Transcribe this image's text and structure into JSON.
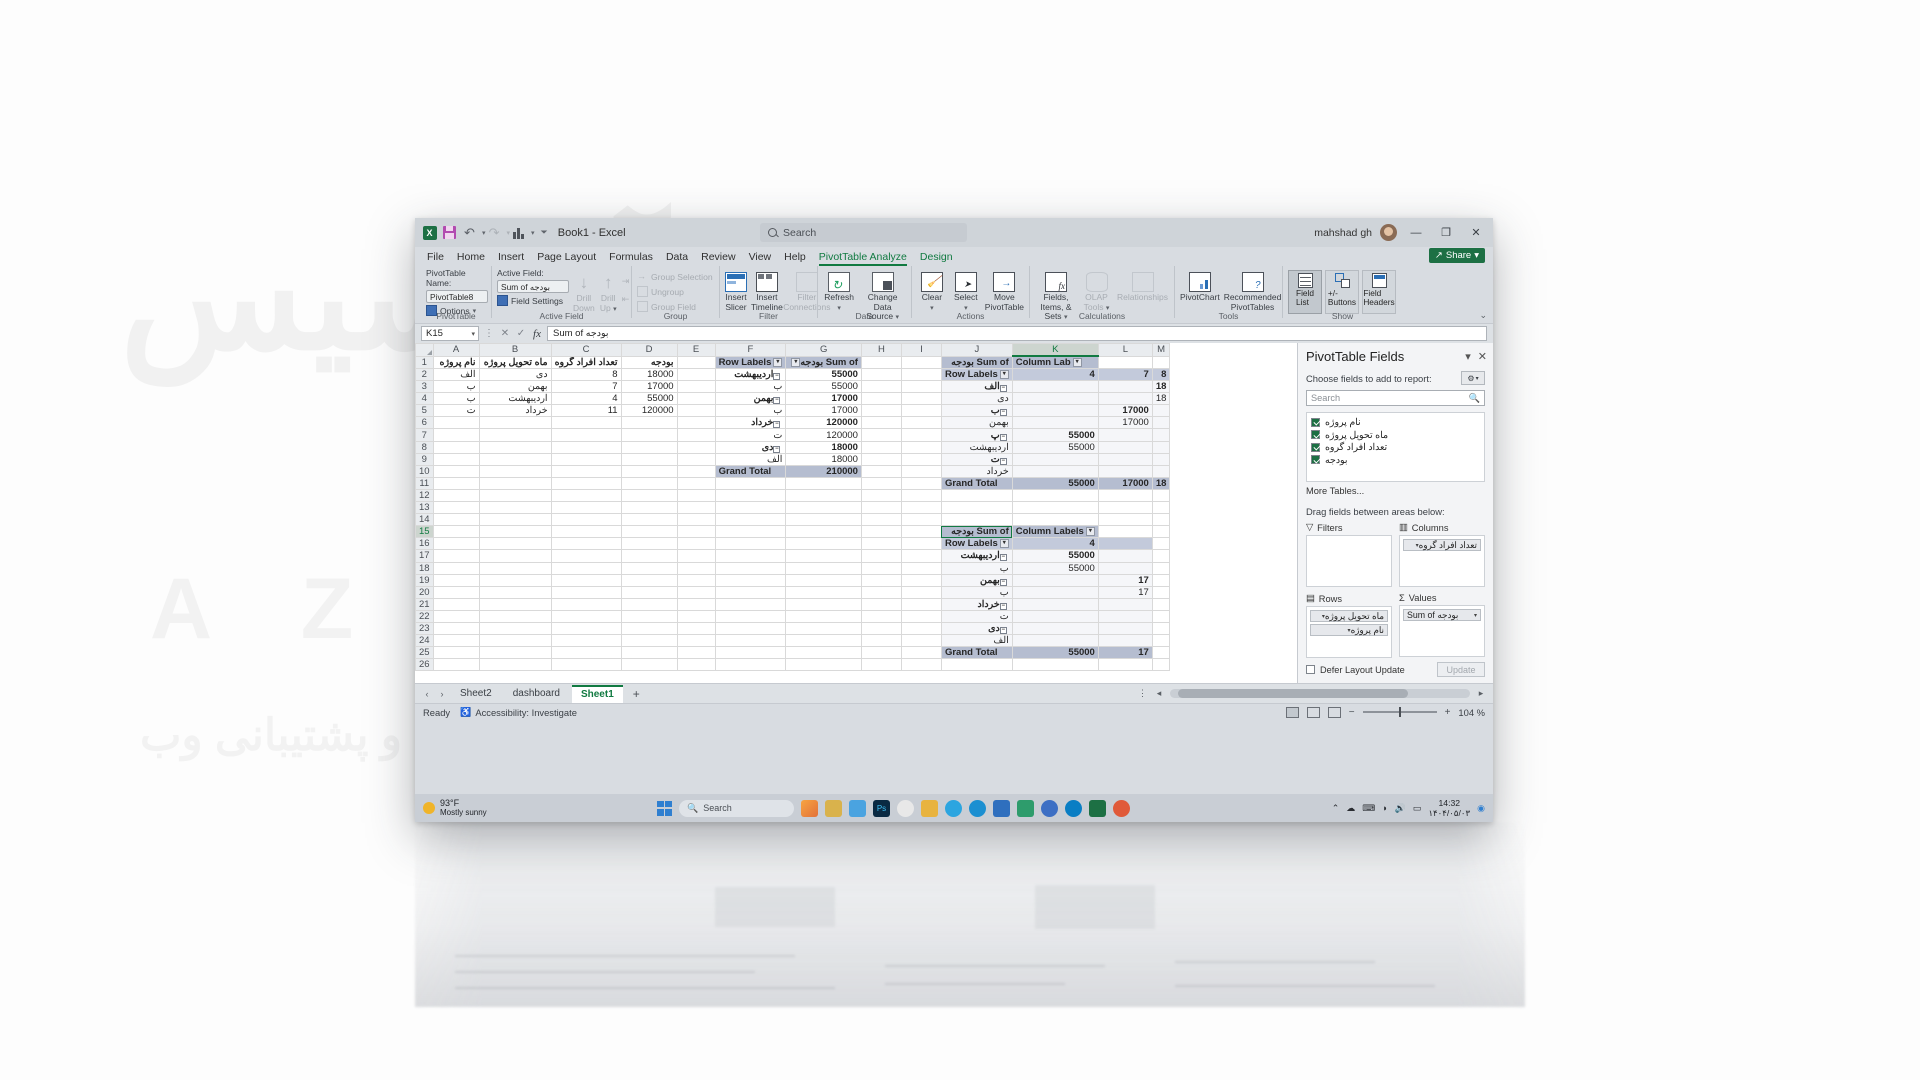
{
  "window": {
    "title": "Book1  -  Excel",
    "user": "mahshad gh",
    "buttons": {
      "minimize": "—",
      "maximize": "❐",
      "close": "✕"
    },
    "share_label": "Share"
  },
  "quick_access": {
    "excel_logo": "X",
    "items": [
      "save-icon",
      "undo-icon",
      "redo-icon",
      "chart-icon",
      "customize-icon"
    ]
  },
  "search": {
    "placeholder": "Search"
  },
  "ribbon": {
    "tabs": [
      "File",
      "Home",
      "Insert",
      "Page Layout",
      "Formulas",
      "Data",
      "Review",
      "View",
      "Help"
    ],
    "context_tabs": [
      "PivotTable Analyze",
      "Design"
    ],
    "active_tab": "PivotTable Analyze",
    "groups": [
      {
        "name": "PivotTable",
        "pivottable_name_label": "PivotTable Name:",
        "pivottable_name_value": "PivotTable8",
        "options_label": "Options"
      },
      {
        "name": "Active Field",
        "active_field_label": "Active Field:",
        "active_field_value": "Sum of بودجه",
        "field_settings_label": "Field Settings",
        "drill_down_label": "Drill Down",
        "drill_up_label": "Drill Up"
      },
      {
        "name": "Group",
        "items": [
          "Group Selection",
          "Ungroup",
          "Group Field"
        ]
      },
      {
        "name": "Filter",
        "items": [
          "Insert Slicer",
          "Insert Timeline",
          "Filter Connections"
        ]
      },
      {
        "name": "Data",
        "items": [
          "Refresh",
          "Change Data Source"
        ]
      },
      {
        "name": "Actions",
        "items": [
          "Clear",
          "Select",
          "Move PivotTable"
        ]
      },
      {
        "name": "Calculations",
        "items": [
          "Fields, Items, & Sets",
          "OLAP Tools",
          "Relationships"
        ]
      },
      {
        "name": "Tools",
        "items": [
          "PivotChart",
          "Recommended PivotTables"
        ]
      },
      {
        "name": "Show",
        "items": [
          "Field List",
          "+/- Buttons",
          "Field Headers"
        ]
      }
    ]
  },
  "formula_bar": {
    "name_box": "K15",
    "formula": "Sum of بودجه",
    "cancel_icon": "✕",
    "enter_icon": "✓",
    "fx_icon": "fx"
  },
  "grid": {
    "columns": [
      "A",
      "B",
      "C",
      "D",
      "E",
      "F",
      "G",
      "H",
      "I",
      "J",
      "K",
      "L",
      "M"
    ],
    "selected_column": "K",
    "rows": [
      1,
      2,
      3,
      4,
      5,
      6,
      7,
      8,
      9,
      10,
      11,
      12,
      13,
      14,
      15,
      16,
      17,
      18,
      19,
      20,
      21,
      22,
      23,
      24,
      25,
      26
    ],
    "selected_row": 15,
    "source_table": {
      "headers": [
        "نام پروژه",
        "ماه تحویل پروژه",
        "تعداد افراد گروه",
        "بودجه"
      ],
      "rows": [
        [
          "الف",
          "دی",
          "8",
          "18000"
        ],
        [
          "ب",
          "بهمن",
          "7",
          "17000"
        ],
        [
          "ب",
          "اردیبهشت",
          "4",
          "55000"
        ],
        [
          "ت",
          "خرداد",
          "11",
          "120000"
        ]
      ]
    },
    "pivot1": {
      "header_row_labels": "Row Labels",
      "header_value": "Sum of بودجه",
      "rows": [
        {
          "label": "اردیبهشت",
          "expand": true,
          "value": "55000",
          "bold": true
        },
        {
          "label": "ب",
          "expand": false,
          "value": "55000",
          "bold": false
        },
        {
          "label": "بهمن",
          "expand": true,
          "value": "17000",
          "bold": true
        },
        {
          "label": "ب",
          "expand": false,
          "value": "17000",
          "bold": false
        },
        {
          "label": "خرداد",
          "expand": true,
          "value": "120000",
          "bold": true
        },
        {
          "label": "ت",
          "expand": false,
          "value": "120000",
          "bold": false
        },
        {
          "label": "دی",
          "expand": true,
          "value": "18000",
          "bold": true
        },
        {
          "label": "الف",
          "expand": false,
          "value": "18000",
          "bold": false
        }
      ],
      "grand_total_label": "Grand Total",
      "grand_total_value": "210000"
    },
    "pivot2": {
      "corner_label": "Sum of بودجه",
      "column_labels": "Column Lab",
      "row_labels": "Row Labels",
      "col_headers": [
        "4",
        "7",
        "8"
      ],
      "rows": [
        {
          "label": "الف",
          "expand": true,
          "cells": [
            "",
            "",
            "18"
          ]
        },
        {
          "label": "دی",
          "expand": false,
          "cells": [
            "",
            "",
            "18"
          ]
        },
        {
          "label": "ب",
          "expand": true,
          "cells": [
            "",
            "17000",
            ""
          ]
        },
        {
          "label": "بهمن",
          "expand": false,
          "cells": [
            "",
            "17000",
            ""
          ]
        },
        {
          "label": "پ",
          "expand": true,
          "cells": [
            "55000",
            "",
            ""
          ]
        },
        {
          "label": "اردیبهشت",
          "expand": false,
          "cells": [
            "55000",
            "",
            ""
          ]
        },
        {
          "label": "ت",
          "expand": true,
          "cells": [
            "",
            "",
            ""
          ]
        },
        {
          "label": "خرداد",
          "expand": false,
          "cells": [
            "",
            "",
            ""
          ]
        }
      ],
      "grand_total_label": "Grand Total",
      "grand_total_cells": [
        "55000",
        "17000",
        "18"
      ]
    },
    "pivot3": {
      "corner_label": "Sum of بودجه",
      "column_labels": "Column Labels",
      "row_labels": "Row Labels",
      "col_headers": [
        "4",
        ""
      ],
      "rows": [
        {
          "label": "اردیبهشت",
          "expand": true,
          "cells": [
            "55000",
            ""
          ]
        },
        {
          "label": "ب",
          "expand": false,
          "cells": [
            "55000",
            ""
          ]
        },
        {
          "label": "بهمن",
          "expand": true,
          "cells": [
            "",
            "17"
          ]
        },
        {
          "label": "ب",
          "expand": false,
          "cells": [
            "",
            "17"
          ]
        },
        {
          "label": "خرداد",
          "expand": true,
          "cells": [
            "",
            ""
          ]
        },
        {
          "label": "ت",
          "expand": false,
          "cells": [
            "",
            ""
          ]
        },
        {
          "label": "دی",
          "expand": true,
          "cells": [
            "",
            ""
          ]
        },
        {
          "label": "الف",
          "expand": false,
          "cells": [
            "",
            ""
          ]
        }
      ],
      "grand_total_label": "Grand Total",
      "grand_total_cells": [
        "55000",
        "17"
      ]
    }
  },
  "field_pane": {
    "title": "PivotTable Fields",
    "pin_icon": "▾",
    "close_icon": "✕",
    "subtitle": "Choose fields to add to report:",
    "gear_icon": "⚙",
    "search_placeholder": "Search",
    "fields": [
      {
        "label": "نام پروژه",
        "checked": true
      },
      {
        "label": "ماه تحویل پروژه",
        "checked": true
      },
      {
        "label": "تعداد افراد گروه",
        "checked": true
      },
      {
        "label": "بودجه",
        "checked": true
      }
    ],
    "more_tables": "More Tables...",
    "drag_label": "Drag fields between areas below:",
    "areas": [
      {
        "name": "Filters",
        "icon": "filter-icon",
        "chips": []
      },
      {
        "name": "Columns",
        "icon": "columns-icon",
        "chips": [
          "تعداد افراد گروه"
        ]
      },
      {
        "name": "Rows",
        "icon": "rows-icon",
        "chips": [
          "ماه تحویل پروژه",
          "نام پروژه"
        ]
      },
      {
        "name": "Values",
        "icon": "values-icon",
        "chips": [
          "Sum of بودجه"
        ]
      }
    ],
    "defer_label": "Defer Layout Update",
    "update_button": "Update"
  },
  "sheet_tabs": {
    "tabs": [
      "Sheet2",
      "dashboard",
      "Sheet1"
    ],
    "active": "Sheet1",
    "add_label": "+",
    "nav_prev": "‹",
    "nav_next": "›"
  },
  "status_bar": {
    "ready": "Ready",
    "accessibility": "Accessibility: Investigate",
    "zoom": "104 %",
    "zoom_out": "−",
    "zoom_in": "+"
  },
  "taskbar": {
    "weather_temp": "93°F",
    "weather_desc": "Mostly sunny",
    "search_placeholder": "Search",
    "clock_time": "14:32",
    "clock_date": "۱۴۰۴/۰۵/۰۳"
  },
  "watermark": {
    "line1": "آذرسیس",
    "line2": "A Z A R S Y S",
    "line3": "طراحی سایت و پشتیبانی وب"
  },
  "colors": {
    "excel_green": "#117a41",
    "pivot_header": "#b5bdd0",
    "window_chrome": "#d8dce1"
  }
}
